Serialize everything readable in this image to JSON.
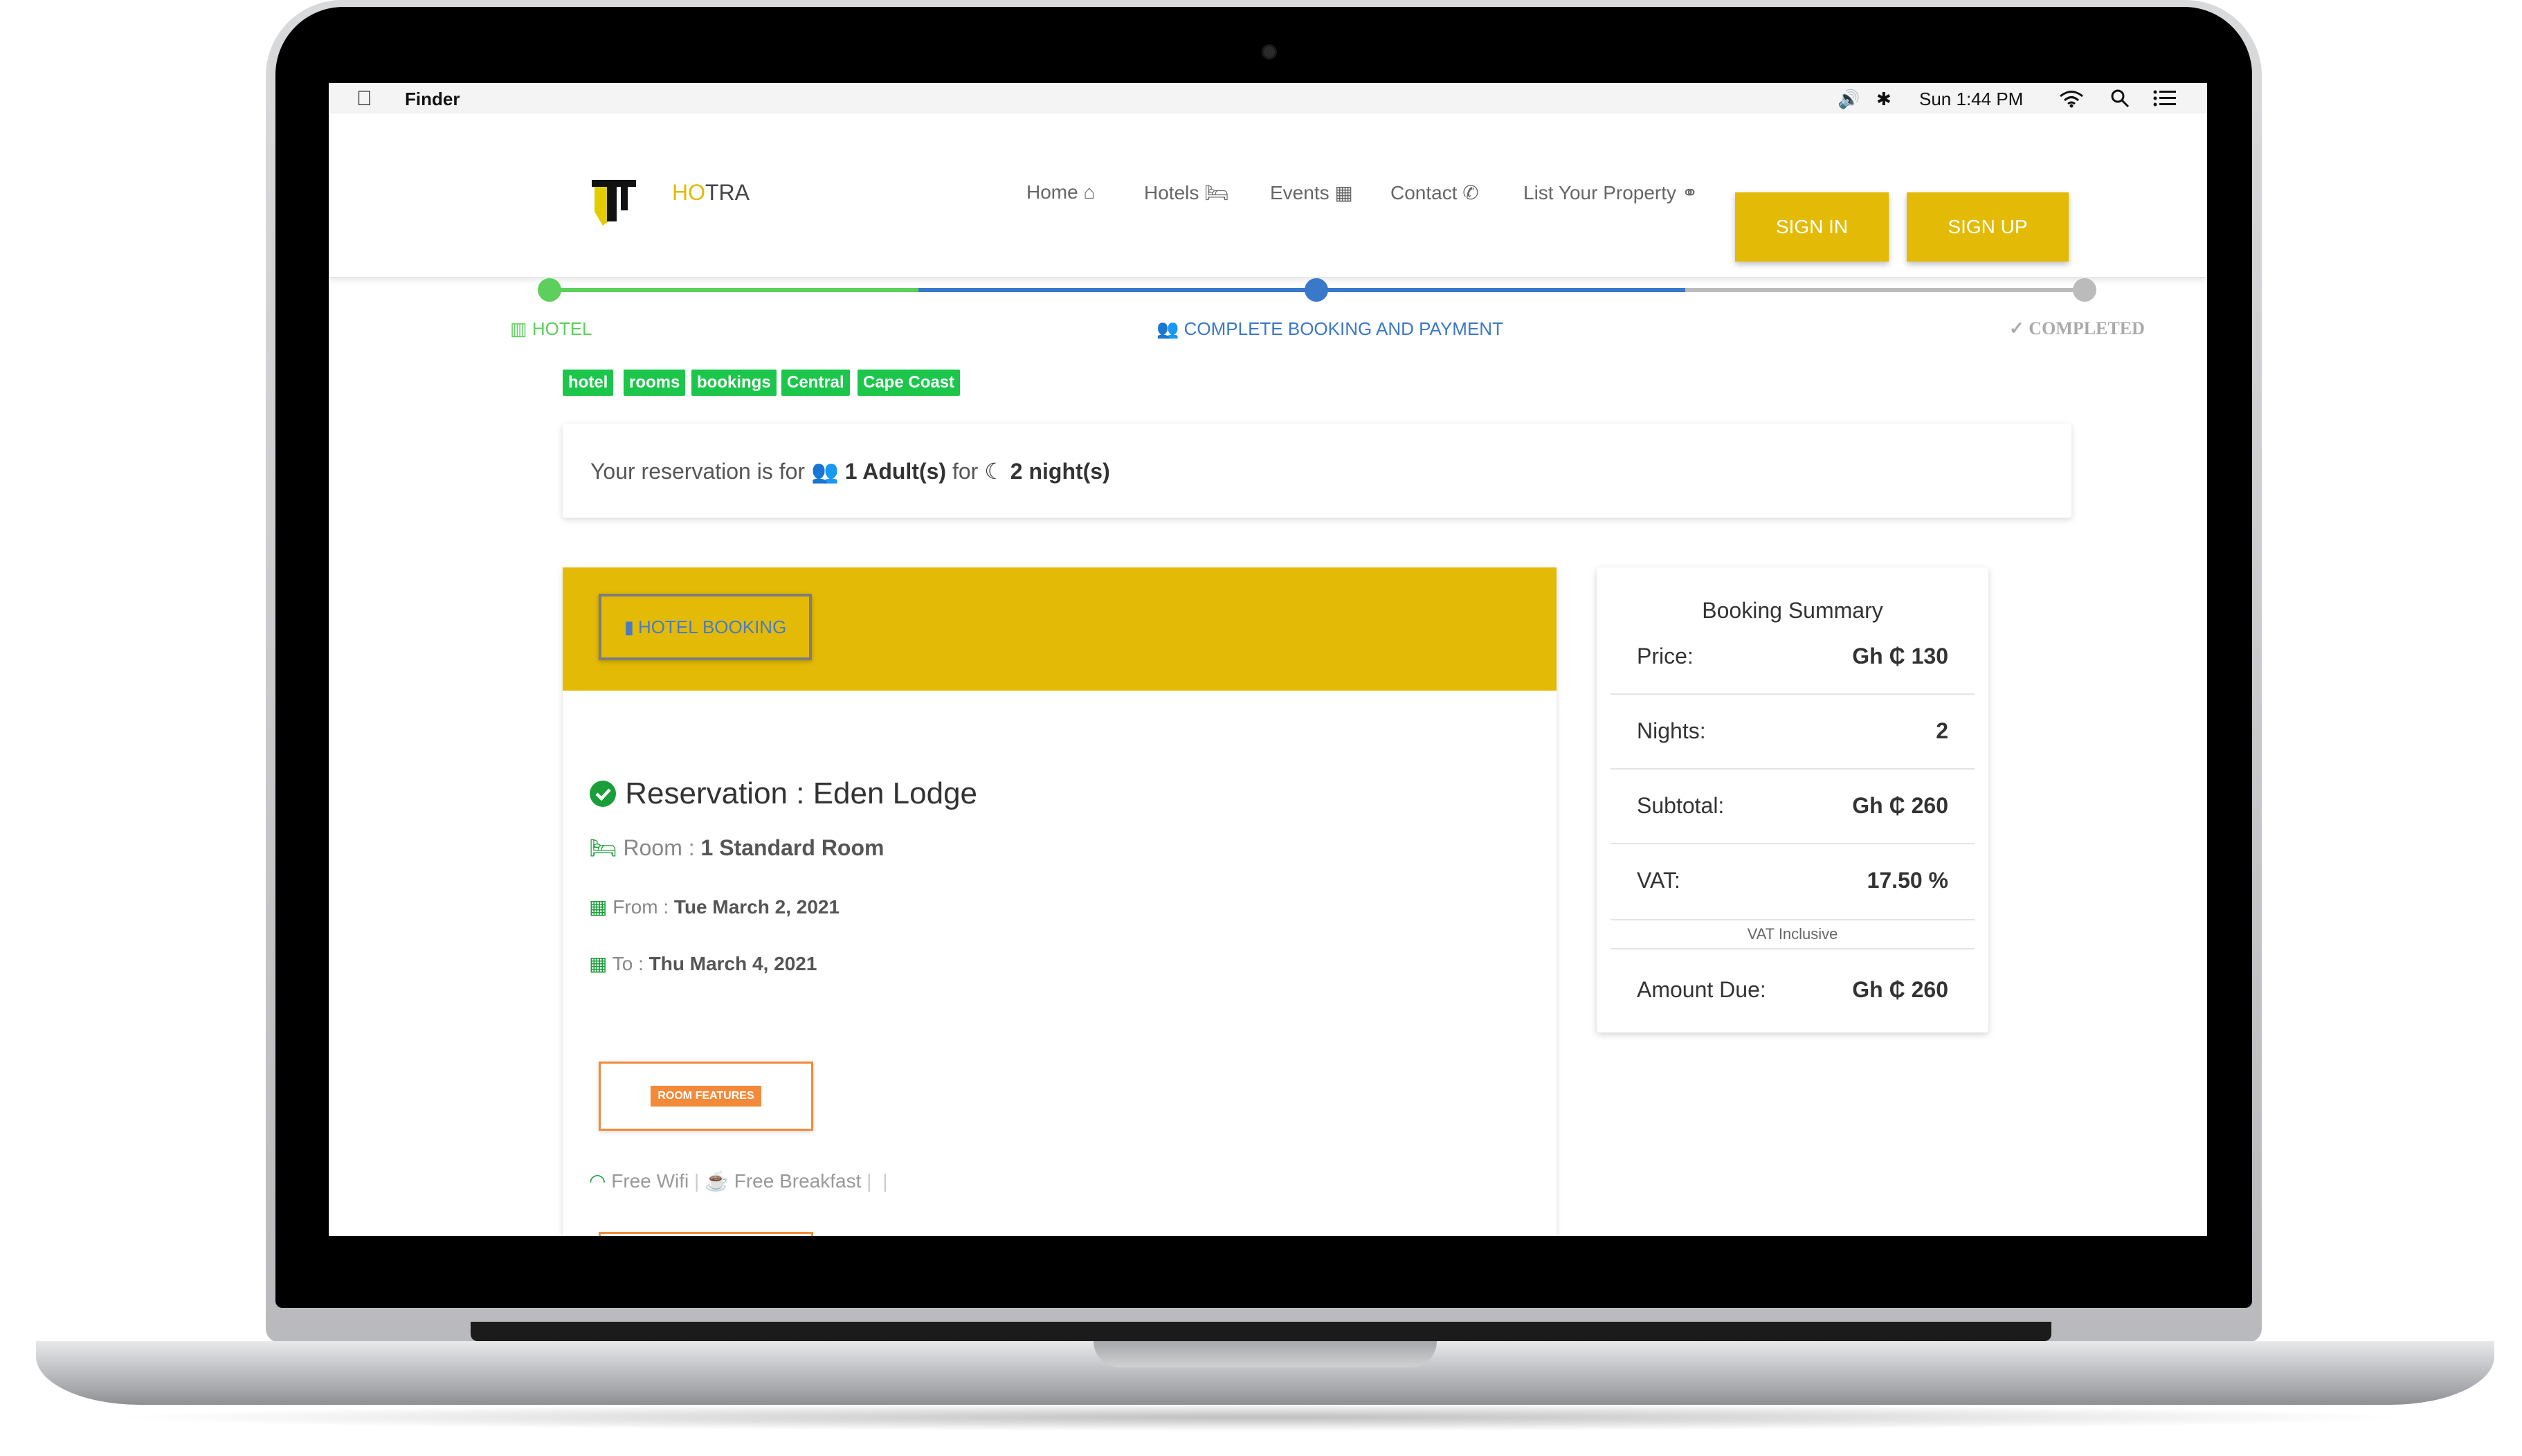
{
  "menubar": {
    "app_name": "Finder",
    "clock": "Sun 1:44 PM"
  },
  "brand": {
    "prefix": "HO",
    "suffix": "TRA"
  },
  "nav": {
    "home": "Home",
    "hotels": "Hotels",
    "events": "Events",
    "contact": "Contact",
    "list_property": "List Your Property",
    "sign_in": "SIGN IN",
    "sign_up": "SIGN UP"
  },
  "progress": {
    "steps": [
      "HOTEL",
      "COMPLETE BOOKING AND PAYMENT",
      "COMPLETED"
    ],
    "done_color": "#5ccf5c",
    "active_color": "#3a78c9",
    "pending_color": "#bbbbbb"
  },
  "tags": [
    "hotel",
    "rooms",
    "bookings",
    "Central",
    "Cape Coast"
  ],
  "reservation_banner": {
    "prefix": "Your reservation is for",
    "adults": "1 Adult(s)",
    "middle": "for",
    "nights": "2 night(s)"
  },
  "booking": {
    "header_button": "HOTEL BOOKING",
    "title": "Reservation : Eden Lodge",
    "room_label": "Room :",
    "room_value": "1 Standard Room",
    "from_label": "From :",
    "from_value": "Tue March 2, 2021",
    "to_label": "To :",
    "to_value": "Thu March 4, 2021",
    "features_button": "ROOM FEATURES",
    "features": [
      "Free Wifi",
      "Free Breakfast"
    ]
  },
  "summary": {
    "title": "Booking Summary",
    "rows": [
      {
        "label": "Price:",
        "value": "Gh ₵ 130"
      },
      {
        "label": "Nights:",
        "value": "2"
      },
      {
        "label": "Subtotal:",
        "value": "Gh ₵ 260"
      },
      {
        "label": "VAT:",
        "value": "17.50 %"
      }
    ],
    "vat_note": "VAT Inclusive",
    "amount_due_label": "Amount Due:",
    "amount_due_value": "Gh ₵ 260"
  },
  "colors": {
    "accent": "#e3bb07",
    "tag_green": "#1bc64a",
    "check_green": "#1a9e3a",
    "orange": "#f28a3a"
  }
}
